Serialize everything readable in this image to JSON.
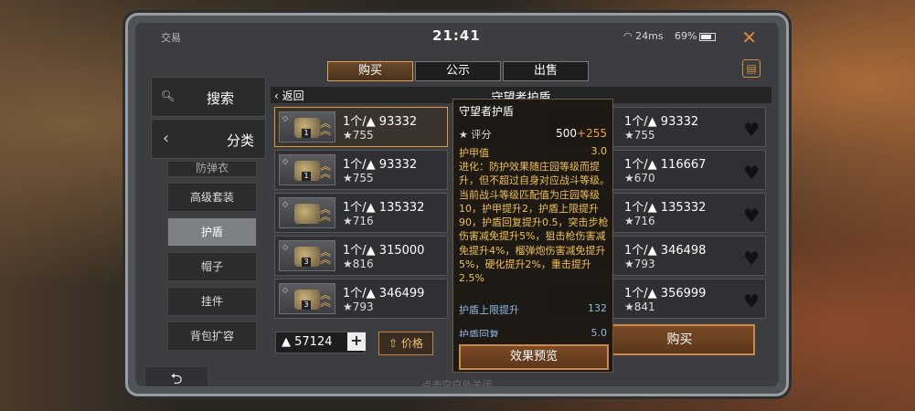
{
  "status": {
    "app": "交易",
    "time": "21:41",
    "net": "24ms",
    "battery": "69%"
  },
  "tabs": [
    "购买",
    "公示",
    "出售"
  ],
  "sidebar": {
    "search": "搜索",
    "category": "分类",
    "items": [
      "防弹衣",
      "高级套装",
      "护盾",
      "帽子",
      "挂件",
      "背包扩容"
    ]
  },
  "header": {
    "back": "返回",
    "title": "守望者护盾"
  },
  "listings": [
    {
      "qty": "1个/",
      "price": "93332",
      "score": "755",
      "lvl": "1"
    },
    {
      "qty": "1个/",
      "price": "93332",
      "score": "755",
      "lvl": "1"
    },
    {
      "qty": "1个/",
      "price": "135332",
      "score": "716",
      "lvl": ""
    },
    {
      "qty": "1个/",
      "price": "315000",
      "score": "816",
      "lvl": "3"
    },
    {
      "qty": "1个/",
      "price": "346499",
      "score": "793",
      "lvl": "3"
    }
  ],
  "listings_right": [
    {
      "qty": "1个/",
      "price": "93332",
      "score": "755"
    },
    {
      "qty": "1个/",
      "price": "116667",
      "score": "670"
    },
    {
      "qty": "1个/",
      "price": "135332",
      "score": "716"
    },
    {
      "qty": "1个/",
      "price": "346498",
      "score": "793"
    },
    {
      "qty": "1个/",
      "price": "356999",
      "score": "841"
    }
  ],
  "footer": {
    "coins": "57124",
    "price_btn": "价格",
    "buy": "购买",
    "hint": "点击空白处关闭"
  },
  "tooltip": {
    "name": "守望者护盾",
    "rating_label": "评分",
    "rating_base": "500",
    "rating_bonus": "+255",
    "armor_label": "护甲值",
    "armor_value": "3.0",
    "desc": "进化：防护效果随庄园等级而提升，但不超过自身对应战斗等级。当前战斗等级匹配值为庄园等级10，护甲提升2，护盾上限提升90，护盾回复提升0.5，突击步枪伤害减免提升5%，狙击枪伤害减免提升4%，榴弹炮伤害减免提升5%，硬化提升2%，重击提升2.5%",
    "stat1_label": "护盾上限提升",
    "stat1_value": "132",
    "stat2_label": "护盾回复",
    "stat2_value": "5.0",
    "preview": "效果预览"
  }
}
